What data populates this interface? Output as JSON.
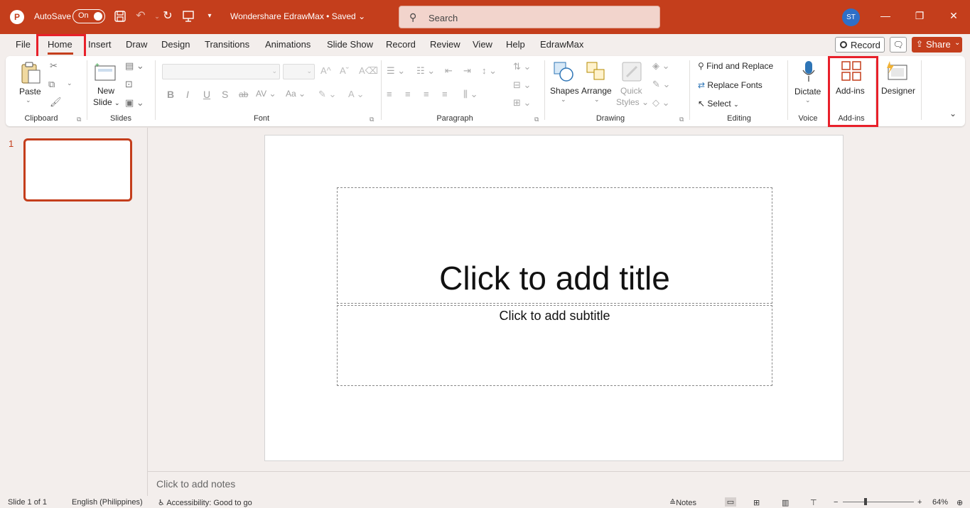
{
  "titlebar": {
    "app_icon": "powerpoint-icon",
    "autosave_label": "AutoSave",
    "autosave_state": "On",
    "doc_title": "Wondershare EdrawMax • Saved",
    "search_placeholder": "Search",
    "avatar_initials": "ST",
    "accent_color": "#c43e1c"
  },
  "tabs": [
    "File",
    "Home",
    "Insert",
    "Draw",
    "Design",
    "Transitions",
    "Animations",
    "Slide Show",
    "Record",
    "Review",
    "View",
    "Help",
    "EdrawMax"
  ],
  "active_tab": "Home",
  "right_buttons": {
    "record": "Record",
    "share": "Share"
  },
  "ribbon": {
    "clipboard": {
      "paste": "Paste",
      "group": "Clipboard"
    },
    "slides": {
      "new_slide_line1": "New",
      "new_slide_line2": "Slide",
      "group": "Slides"
    },
    "font": {
      "group": "Font",
      "bold": "B",
      "italic": "I",
      "underline": "U",
      "shadow": "S",
      "strike": "ab",
      "spacing": "AV",
      "case": "Aa"
    },
    "paragraph": {
      "group": "Paragraph"
    },
    "drawing": {
      "shapes": "Shapes",
      "arrange": "Arrange",
      "quick_styles_1": "Quick",
      "quick_styles_2": "Styles",
      "group": "Drawing"
    },
    "editing": {
      "find_replace": "Find and Replace",
      "replace_fonts": "Replace Fonts",
      "select": "Select",
      "group": "Editing"
    },
    "voice": {
      "dictate": "Dictate",
      "group": "Voice"
    },
    "addins": {
      "addins": "Add-ins",
      "group": "Add-ins"
    },
    "designer": {
      "designer": "Designer"
    }
  },
  "thumbnails": {
    "slide_number": "1"
  },
  "slide": {
    "title_placeholder": "Click to add title",
    "subtitle_placeholder": "Click to add subtitle"
  },
  "notes": {
    "placeholder": "Click to add notes"
  },
  "status": {
    "slide_count": "Slide 1 of 1",
    "language": "English (Philippines)",
    "accessibility": "Accessibility: Good to go",
    "notes": "Notes",
    "zoom": "64%"
  }
}
